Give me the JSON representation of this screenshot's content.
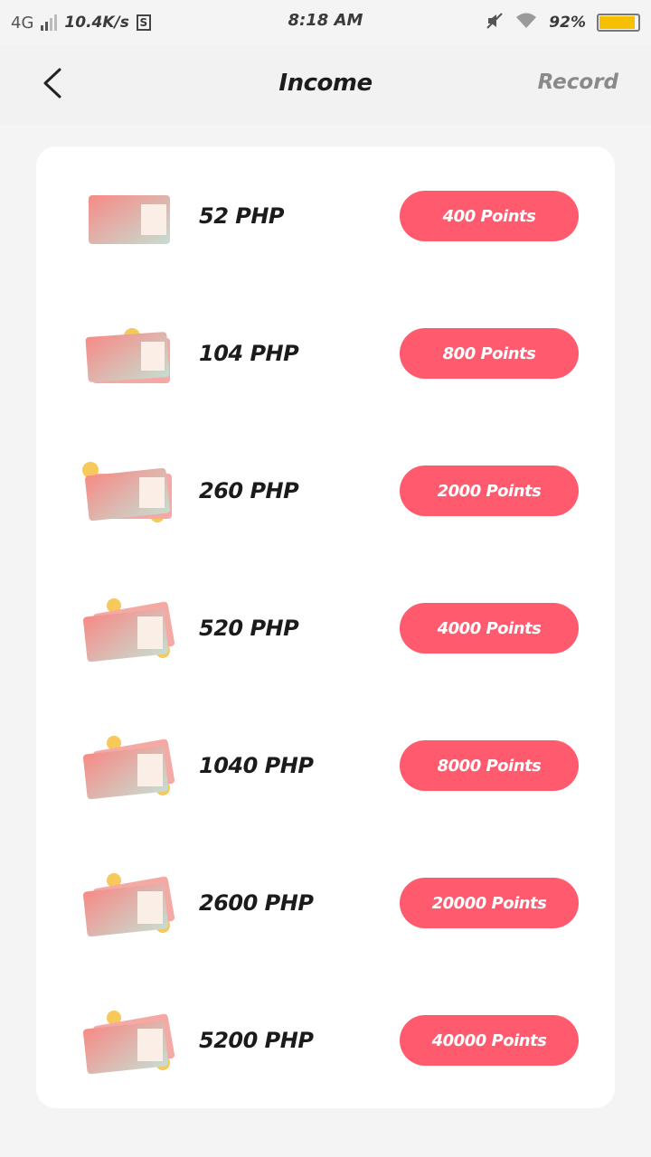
{
  "status_bar": {
    "network": "4G",
    "speed": "10.4K/s",
    "sim_icon": "S",
    "time": "8:18 AM",
    "battery": "92%",
    "icons": [
      "signal-icon",
      "sim-icon",
      "mute-icon",
      "wifi-icon",
      "battery-icon"
    ]
  },
  "header": {
    "title": "Income",
    "record_label": "Record",
    "back_icon": "chevron-left-icon"
  },
  "colors": {
    "accent": "#ff5a6e",
    "battery": "#f6c000",
    "background": "#f4f4f4"
  },
  "items": [
    {
      "amount": "52 PHP",
      "points": "400 Points",
      "icon": "cash-stack-icon"
    },
    {
      "amount": "104 PHP",
      "points": "800 Points",
      "icon": "cash-stack-icon"
    },
    {
      "amount": "260 PHP",
      "points": "2000 Points",
      "icon": "cash-stack-icon"
    },
    {
      "amount": "520 PHP",
      "points": "4000 Points",
      "icon": "cash-stack-icon"
    },
    {
      "amount": "1040 PHP",
      "points": "8000 Points",
      "icon": "cash-stack-icon"
    },
    {
      "amount": "2600 PHP",
      "points": "20000 Points",
      "icon": "cash-stack-icon"
    },
    {
      "amount": "5200 PHP",
      "points": "40000 Points",
      "icon": "cash-stack-icon"
    }
  ]
}
